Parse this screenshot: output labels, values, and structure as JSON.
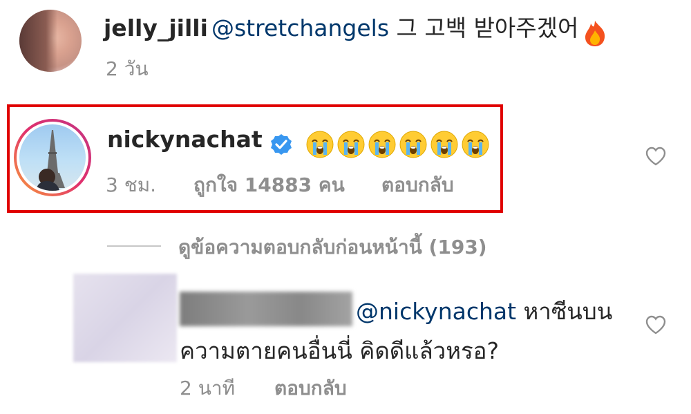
{
  "comment1": {
    "username": "jelly_jilli",
    "mention": "@stretchangels",
    "text": " 그 고백 받아주겠어",
    "emoji_icon": "fire-icon",
    "time": "2 วัน"
  },
  "comment2": {
    "username": "nickynachat",
    "verified_icon": "verified-badge-icon",
    "emoji_icon": "crying-face-icon",
    "emoji_count": 6,
    "time": "3 ชม.",
    "likes": "ถูกใจ 14883 คน",
    "reply": "ตอบกลับ",
    "highlight_color": "#e00000"
  },
  "view_replies": "ดูข้อความตอบกลับก่อนหน้านี้ (193)",
  "comment3": {
    "mention": "@nickynachat",
    "text_line1": " หาซีนบน",
    "text_line2": "ความตายคนอื่นนี่ คิดดีแล้วหรอ?",
    "time": "2 นาที",
    "reply": "ตอบกลับ"
  },
  "colors": {
    "text": "#262626",
    "secondary": "#8e8e8e",
    "mention": "#00376b",
    "verified": "#3897f0"
  }
}
